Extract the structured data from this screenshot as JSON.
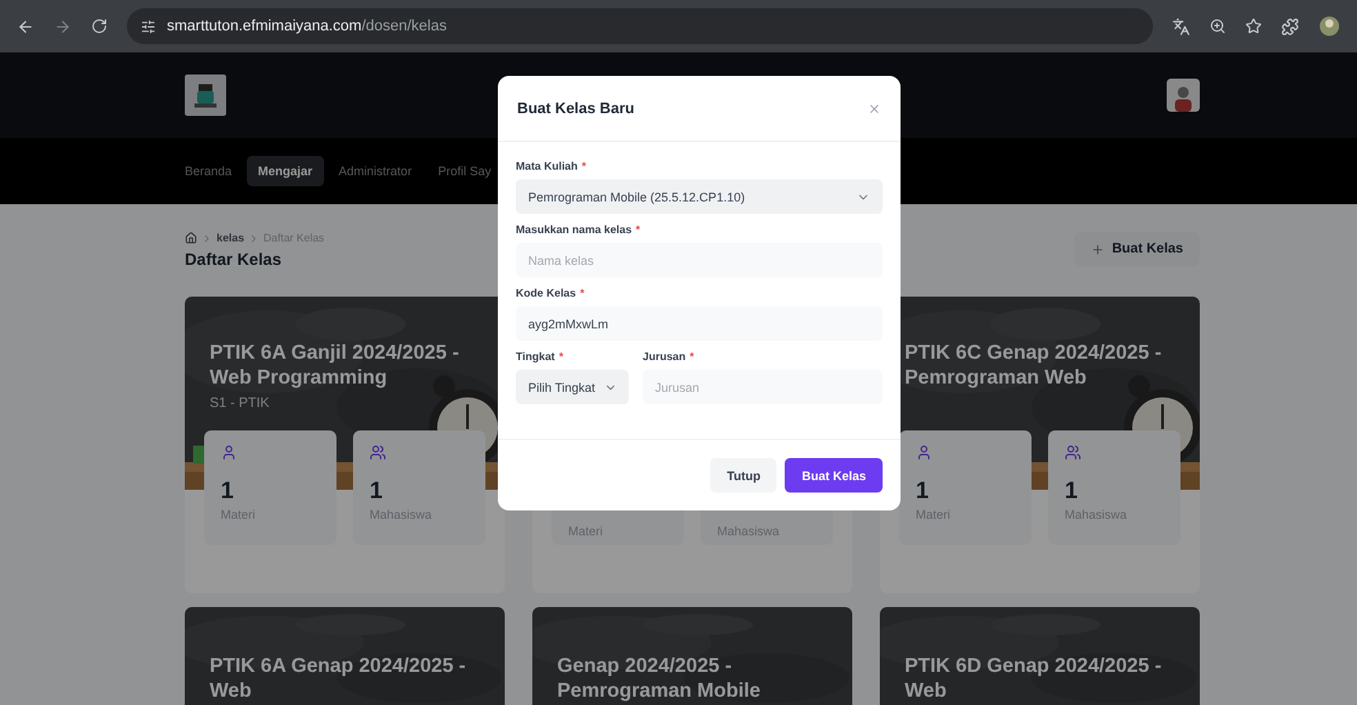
{
  "browser": {
    "url_host": "smarttuton.efmimaiyana.com",
    "url_path": "/dosen/kelas"
  },
  "nav": {
    "items": [
      {
        "label": "Beranda",
        "selected": false
      },
      {
        "label": "Mengajar",
        "selected": true
      },
      {
        "label": "Administrator",
        "selected": false
      },
      {
        "label": "Profil Say",
        "selected": false
      }
    ]
  },
  "breadcrumb": [
    "kelas",
    "Daftar Kelas"
  ],
  "page_title": "Daftar Kelas",
  "create_button": "Buat Kelas",
  "classes": [
    {
      "title": "PTIK 6A Ganjil 2024/2025 - Web Programming",
      "subtitle": "S1 - PTIK",
      "stats": [
        {
          "value": "1",
          "label": "Materi",
          "kind": "materi"
        },
        {
          "value": "1",
          "label": "Mahasiswa",
          "kind": "mahasiswa"
        }
      ]
    },
    {
      "stats": [
        {
          "label": "Materi"
        },
        {
          "label": "Mahasiswa"
        }
      ]
    },
    {
      "title": "PTIK 6C Genap 2024/2025 - Pemrograman Web",
      "stats": [
        {
          "value": "1",
          "label": "Materi",
          "kind": "materi"
        },
        {
          "value": "1",
          "label": "Mahasiswa",
          "kind": "mahasiswa"
        }
      ]
    },
    {
      "title": "PTIK 6A Genap 2024/2025 - Web"
    },
    {
      "title": "Genap 2024/2025 - Pemrograman Mobile"
    },
    {
      "title": "PTIK 6D Genap 2024/2025 - Web"
    }
  ],
  "modal": {
    "title": "Buat Kelas Baru",
    "fields": [
      {
        "kind": "select",
        "label": "Mata Kuliah",
        "mark": "*",
        "value": "Pemrograman Mobile (25.5.12.CP1.10)"
      },
      {
        "kind": "input",
        "label": "Masukkan nama kelas",
        "mark": "*",
        "placeholder": "Nama kelas"
      },
      {
        "kind": "input",
        "label": "Kode Kelas",
        "mark": "*",
        "value": "ayg2mMxwLm"
      }
    ],
    "row_fields": [
      {
        "kind": "select",
        "label": "Tingkat",
        "mark": "*",
        "value": "Pilih Tingkat"
      },
      {
        "kind": "input",
        "label": "Jurusan",
        "mark": "*",
        "placeholder": "Jurusan"
      }
    ],
    "buttons": [
      {
        "label": "Tutup",
        "kind": "secondary"
      },
      {
        "label": "Buat Kelas",
        "kind": "primary"
      }
    ]
  }
}
